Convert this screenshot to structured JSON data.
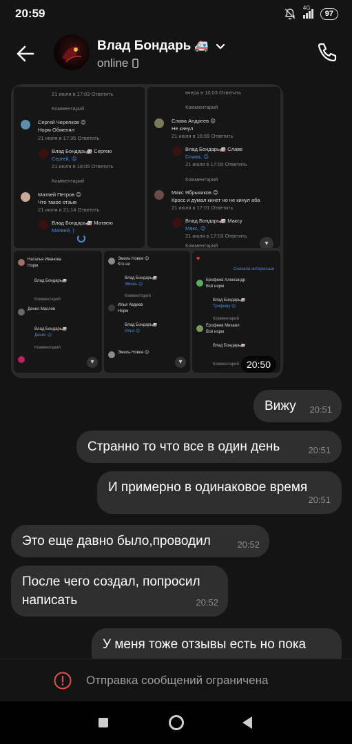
{
  "status_bar": {
    "time": "20:59",
    "network": "4G",
    "battery": "97"
  },
  "header": {
    "name": "Влад Бондарь",
    "name_emoji": "🚑",
    "status": "online"
  },
  "media": {
    "duration": "20:50",
    "tile1": {
      "l1": "21 июля в 17:03   Ответить",
      "l2": "Комментарий",
      "l3": "Сергей Черепков 😊",
      "l4": "Норм Обменял",
      "l5": "21 июля в 17:35   Ответить",
      "l6": "Влад Бондарь🚑  Сергею",
      "l7": "Сергей, 😊",
      "l8": "21 июля в 18:05   Ответить",
      "l9": "Комментарий",
      "l10": "Матвей Петров 😊",
      "l11": "Что такое отзыв",
      "l12": "21 июля в 21:14   Ответить",
      "l13": "Влад Бондарь🚑  Матвею",
      "l14": "Матвей, )"
    },
    "tile2": {
      "l1": "вчера в 10:03   Ответить",
      "l2": "Комментарий",
      "l3": "Слава Андреев 😊",
      "l4": "Не кинул",
      "l5": "21 июля в 16:59   Ответить",
      "l6": "Влад Бондарь🚑  Славе",
      "l7": "Слава, 😊",
      "l8": "21 июля в 17:00   Ответить",
      "l9": "Комментарий",
      "l10": "Макс Ябрыкиков 😊",
      "l11": "Кросс и думал кинет но не кинул аба",
      "l12": "21 июля в 17:01   Ответить",
      "l13": "Влад Бондарь🚑  Максу",
      "l14": "Макс, 😊",
      "l15": "21 июля в 17:03   Ответить",
      "l16": "Комментарий"
    },
    "tile3": {
      "l1": "Наталья Иванова",
      "l2": "Норм",
      "l3": "Влад Бондарь🚑",
      "l4": "Комментарий",
      "l5": "Денис Маслов",
      "l6": "Влад Бондарь🚑",
      "l7": "Денис 😊",
      "l8": "Комментарий"
    },
    "tile4": {
      "l1": "Эмиль Новое 😊",
      "l2": "Кто не",
      "l3": "Влад Бондарь🚑",
      "l4": "Эмиль 😊",
      "l5": "Комментарий",
      "l6": "Илья Авдеев",
      "l7": "Норм",
      "l8": "Влад Бондарь🚑",
      "l9": "Илья 😊",
      "l10": "Эмиль Новое 😊"
    },
    "tile5": {
      "l1": "Сначала интересные",
      "l2": "Ерофеев Александр",
      "l3": "Всё норм",
      "l4": "Влад Бондарь🚑",
      "l5": "Трофиму 😊",
      "l6": "Комментарий",
      "l7": "Ерофеев Михаил",
      "l8": "Всё норм",
      "l9": "Влад Бондарь🚑",
      "l10": "Комментарий"
    }
  },
  "messages": [
    {
      "text": "Вижу",
      "time": "20:51"
    },
    {
      "text": "Странно то что все в один день",
      "time": "20:51"
    },
    {
      "text": "И примерно в одинаковое время",
      "time": "20:51"
    },
    {
      "text": "Это еще давно было,проводил",
      "time": "20:52"
    },
    {
      "text": "После чего создал, попросил написать",
      "time": "20:52"
    },
    {
      "text": "У меня тоже отзывы есть но пока",
      "time": ""
    }
  ],
  "restriction": {
    "text": "Отправка сообщений ограничена"
  }
}
